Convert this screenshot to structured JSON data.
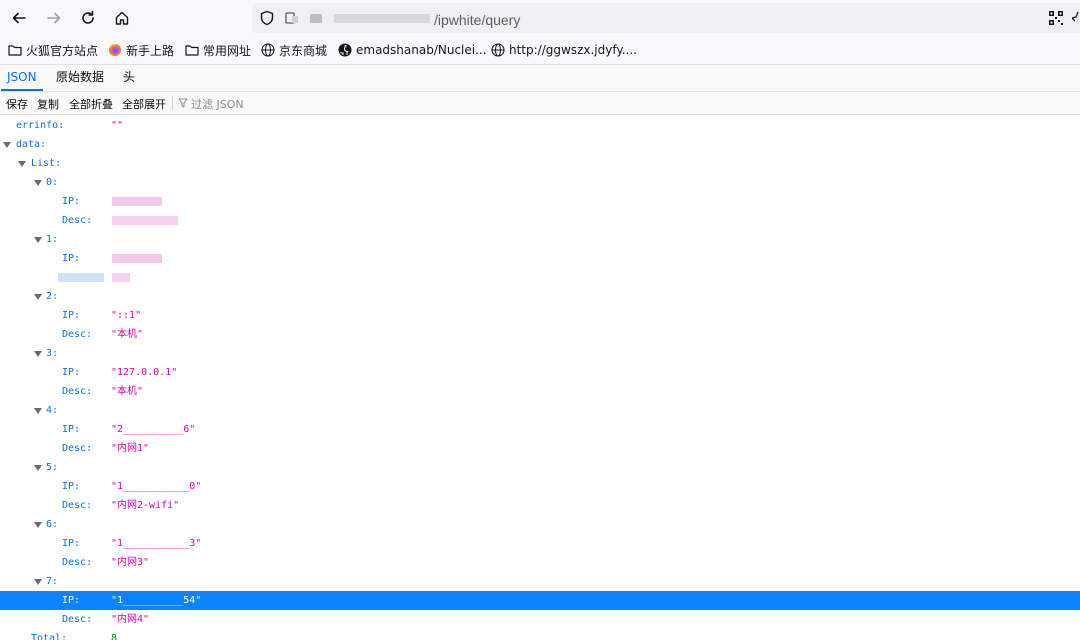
{
  "browser": {
    "url_suffix": "/ipwhite/query",
    "bookmarks": [
      {
        "label": "火狐官方站点",
        "icon": "folder-icon"
      },
      {
        "label": "新手上路",
        "icon": "firefox-icon"
      },
      {
        "label": "常用网址",
        "icon": "folder-icon"
      },
      {
        "label": "京东商城",
        "icon": "globe-icon"
      },
      {
        "label": "emadshanab/Nuclei...",
        "icon": "github-icon"
      },
      {
        "label": "http://ggwszx.jdyfy....",
        "icon": "globe-icon"
      }
    ]
  },
  "viewer": {
    "tabs": [
      "JSON",
      "原始数据",
      "头"
    ],
    "toolbar": {
      "save": "保存",
      "copy": "复制",
      "collapse_all": "全部折叠",
      "expand_all": "全部展开",
      "filter_placeholder": "过滤 JSON"
    }
  },
  "tree": {
    "errinfo_key": "errinfo:",
    "errinfo_val": "\"\"",
    "data_key": "data:",
    "list_key": "List:",
    "items": [
      {
        "index": "0:",
        "ip_key": "IP:",
        "ip_val": "",
        "desc_key": "Desc:",
        "desc_val": ""
      },
      {
        "index": "1:",
        "ip_key": "IP:",
        "ip_val": "",
        "desc_key": "",
        "desc_val": ""
      },
      {
        "index": "2:",
        "ip_key": "IP:",
        "ip_val": "\"::1\"",
        "desc_key": "Desc:",
        "desc_val": "\"本机\""
      },
      {
        "index": "3:",
        "ip_key": "IP:",
        "ip_val": "\"127.0.0.1\"",
        "desc_key": "Desc:",
        "desc_val": "\"本机\""
      },
      {
        "index": "4:",
        "ip_key": "IP:",
        "ip_val": "\"2__________6\"",
        "desc_key": "Desc:",
        "desc_val": "\"内网1\""
      },
      {
        "index": "5:",
        "ip_key": "IP:",
        "ip_val": "\"1___________0\"",
        "desc_key": "Desc:",
        "desc_val": "\"内网2-wifi\""
      },
      {
        "index": "6:",
        "ip_key": "IP:",
        "ip_val": "\"1___________3\"",
        "desc_key": "Desc:",
        "desc_val": "\"内网3\""
      },
      {
        "index": "7:",
        "ip_key": "IP:",
        "ip_val": "\"1__________54\"",
        "desc_key": "Desc:",
        "desc_val": "\"内网4\""
      }
    ],
    "total_key": "Total:",
    "total_val": "8"
  },
  "colors": {
    "key": "#0074e8",
    "string": "#dd00a9",
    "selection": "#0a84ff"
  }
}
